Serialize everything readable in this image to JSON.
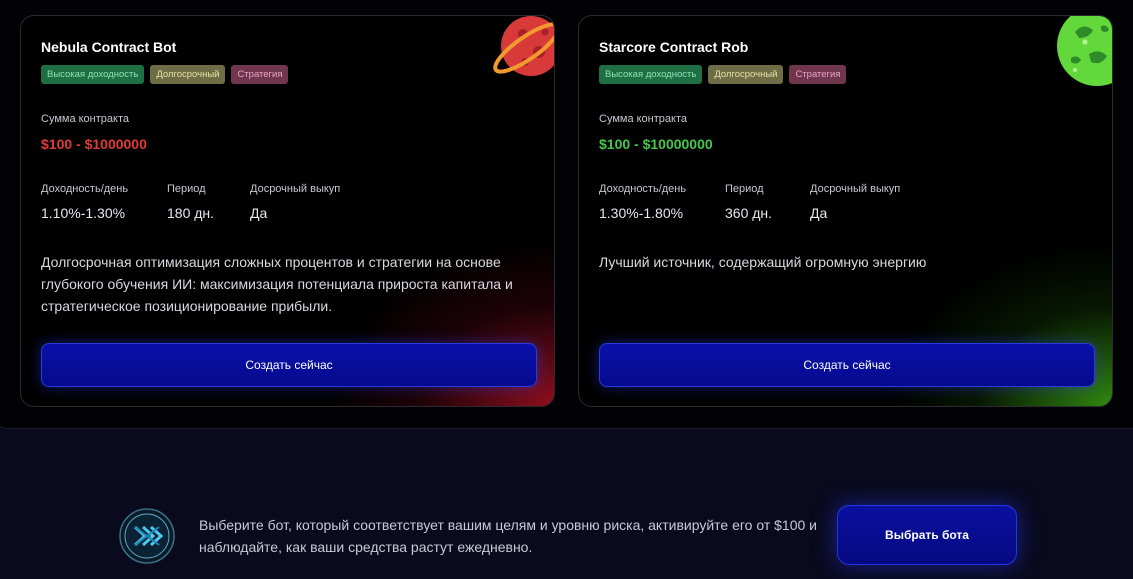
{
  "cards": [
    {
      "title": "Nebula Contract Bot",
      "tags": [
        "Высокая доходность",
        "Долгосрочный",
        "Стратегия"
      ],
      "sum_label": "Сумма контракта",
      "amount": "$100 - $1000000",
      "amount_color": "#e03a3a",
      "stats": [
        {
          "label": "Доходность/день",
          "value": "1.10%-1.30%"
        },
        {
          "label": "Период",
          "value": "180 дн."
        },
        {
          "label": "Досрочный выкуп",
          "value": "Да"
        }
      ],
      "description": "Долгосрочная оптимизация сложных процентов и стратегии на основе глубокого обучения ИИ: максимизация потенциала прироста капитала и стратегическое позиционирование прибыли.",
      "button": "Создать сейчас",
      "planet_icon": "red-planet-icon"
    },
    {
      "title": "Starcore Contract Rob",
      "tags": [
        "Высокая доходность",
        "Долгосрочный",
        "Стратегия"
      ],
      "sum_label": "Сумма контракта",
      "amount": "$100 - $10000000",
      "amount_color": "#43c84b",
      "stats": [
        {
          "label": "Доходность/день",
          "value": "1.30%-1.80%"
        },
        {
          "label": "Период",
          "value": "360 дн."
        },
        {
          "label": "Досрочный выкуп",
          "value": "Да"
        }
      ],
      "description": "Лучший источник, содержащий огромную энергию",
      "button": "Создать сейчас",
      "planet_icon": "green-planet-icon"
    }
  ],
  "footer": {
    "text": "Выберите бот, который соответствует вашим целям и уровню риска, активируйте его от $100 и наблюдайте, как ваши средства растут ежедневно.",
    "button": "Выбрать бота",
    "logo_icon": "bot-logo-icon"
  }
}
